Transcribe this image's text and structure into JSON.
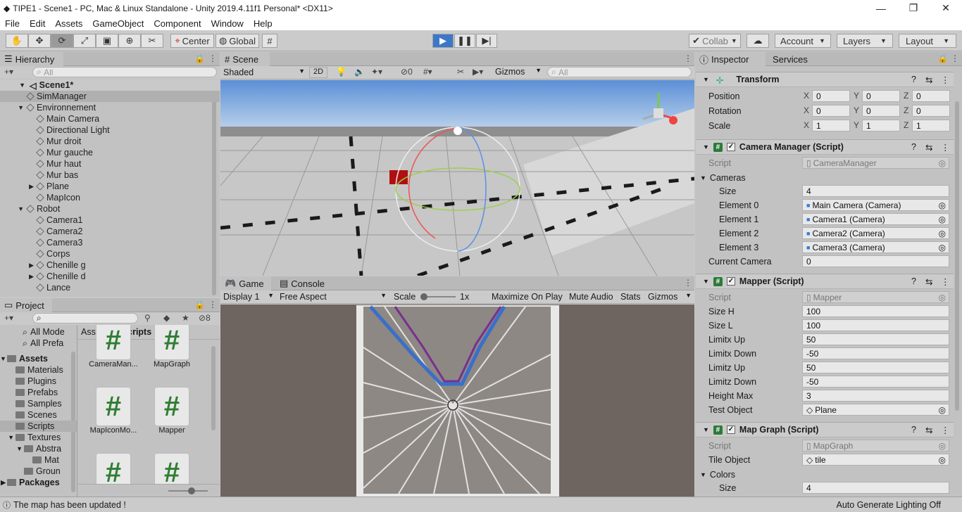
{
  "window": {
    "title": "TIPE1 - Scene1 - PC, Mac & Linux Standalone - Unity 2019.4.11f1 Personal* <DX11>"
  },
  "menu": [
    "File",
    "Edit",
    "Assets",
    "GameObject",
    "Component",
    "Window",
    "Help"
  ],
  "toolbar": {
    "center": "Center",
    "global": "Global",
    "collab": "Collab",
    "account": "Account",
    "layers": "Layers",
    "layout": "Layout"
  },
  "hierarchy": {
    "tab": "Hierarchy",
    "search_placeholder": "All",
    "scene": "Scene1*",
    "items": [
      {
        "label": "SimManager",
        "indent": 1,
        "fold": ""
      },
      {
        "label": "Environnement",
        "indent": 1,
        "fold": "▼"
      },
      {
        "label": "Main Camera",
        "indent": 2,
        "fold": ""
      },
      {
        "label": "Directional Light",
        "indent": 2,
        "fold": ""
      },
      {
        "label": "Mur droit",
        "indent": 2,
        "fold": ""
      },
      {
        "label": "Mur gauche",
        "indent": 2,
        "fold": ""
      },
      {
        "label": "Mur haut",
        "indent": 2,
        "fold": ""
      },
      {
        "label": "Mur bas",
        "indent": 2,
        "fold": ""
      },
      {
        "label": "Plane",
        "indent": 2,
        "fold": "▶"
      },
      {
        "label": "MapIcon",
        "indent": 2,
        "fold": ""
      },
      {
        "label": "Robot",
        "indent": 1,
        "fold": "▼"
      },
      {
        "label": "Camera1",
        "indent": 2,
        "fold": ""
      },
      {
        "label": "Camera2",
        "indent": 2,
        "fold": ""
      },
      {
        "label": "Camera3",
        "indent": 2,
        "fold": ""
      },
      {
        "label": "Corps",
        "indent": 2,
        "fold": ""
      },
      {
        "label": "Chenille g",
        "indent": 2,
        "fold": "▶"
      },
      {
        "label": "Chenille d",
        "indent": 2,
        "fold": "▶"
      },
      {
        "label": "Lance",
        "indent": 2,
        "fold": ""
      }
    ]
  },
  "scene": {
    "tab": "Scene",
    "shading": "Shaded",
    "mode2d": "2D",
    "hidden_count": "0",
    "gizmos": "Gizmos",
    "search_placeholder": "All"
  },
  "game": {
    "tab": "Game",
    "console_tab": "Console",
    "display": "Display 1",
    "aspect": "Free Aspect",
    "scale_label": "Scale",
    "scale_value": "1x",
    "maximize": "Maximize On Play",
    "mute": "Mute Audio",
    "stats": "Stats",
    "gizmos": "Gizmos"
  },
  "project": {
    "tab": "Project",
    "hidden_count": "8",
    "favorites": [
      "All Mode",
      "All Prefa"
    ],
    "tree": [
      {
        "label": "Assets",
        "indent": 0,
        "fold": "▼",
        "bold": true
      },
      {
        "label": "Materials",
        "indent": 1,
        "fold": ""
      },
      {
        "label": "Plugins",
        "indent": 1,
        "fold": ""
      },
      {
        "label": "Prefabs",
        "indent": 1,
        "fold": ""
      },
      {
        "label": "Samples",
        "indent": 1,
        "fold": ""
      },
      {
        "label": "Scenes",
        "indent": 1,
        "fold": ""
      },
      {
        "label": "Scripts",
        "indent": 1,
        "fold": ""
      },
      {
        "label": "Textures",
        "indent": 1,
        "fold": "▼"
      },
      {
        "label": "Abstra",
        "indent": 2,
        "fold": "▼"
      },
      {
        "label": "Mat",
        "indent": 3,
        "fold": ""
      },
      {
        "label": "Groun",
        "indent": 2,
        "fold": ""
      },
      {
        "label": "Packages",
        "indent": 0,
        "fold": "▶",
        "bold": true
      }
    ],
    "breadcrumb": [
      "Assets",
      "Scripts"
    ],
    "assets": [
      "CameraMan...",
      "MapGraph",
      "MapIconMo...",
      "Mapper",
      "",
      ""
    ]
  },
  "inspector": {
    "tab": "Inspector",
    "services_tab": "Services",
    "transform": {
      "title": "Transform",
      "rows": [
        {
          "label": "Position",
          "x": "0",
          "y": "0",
          "z": "0"
        },
        {
          "label": "Rotation",
          "x": "0",
          "y": "0",
          "z": "0"
        },
        {
          "label": "Scale",
          "x": "1",
          "y": "1",
          "z": "1"
        }
      ]
    },
    "camera_manager": {
      "title": "Camera Manager (Script)",
      "script_label": "Script",
      "script_value": "CameraManager",
      "cameras": "Cameras",
      "size_label": "Size",
      "size_value": "4",
      "elements": [
        {
          "label": "Element 0",
          "value": "Main Camera (Camera)"
        },
        {
          "label": "Element 1",
          "value": "Camera1 (Camera)"
        },
        {
          "label": "Element 2",
          "value": "Camera2 (Camera)"
        },
        {
          "label": "Element 3",
          "value": "Camera3 (Camera)"
        }
      ],
      "current_label": "Current Camera",
      "current_value": "0"
    },
    "mapper": {
      "title": "Mapper (Script)",
      "script_label": "Script",
      "script_value": "Mapper",
      "rows": [
        {
          "label": "Size H",
          "value": "100"
        },
        {
          "label": "Size L",
          "value": "100"
        },
        {
          "label": "Limitx Up",
          "value": "50"
        },
        {
          "label": "Limitx Down",
          "value": "-50"
        },
        {
          "label": "Limitz Up",
          "value": "50"
        },
        {
          "label": "Limitz Down",
          "value": "-50"
        },
        {
          "label": "Height Max",
          "value": "3"
        }
      ],
      "test_label": "Test Object",
      "test_value": "Plane"
    },
    "map_graph": {
      "title": "Map Graph (Script)",
      "script_label": "Script",
      "script_value": "MapGraph",
      "tile_label": "Tile Object",
      "tile_value": "tile",
      "colors": "Colors",
      "size_label": "Size",
      "size_value": "4"
    }
  },
  "status": {
    "message": "The map has been updated !",
    "lighting": "Auto Generate Lighting Off"
  }
}
